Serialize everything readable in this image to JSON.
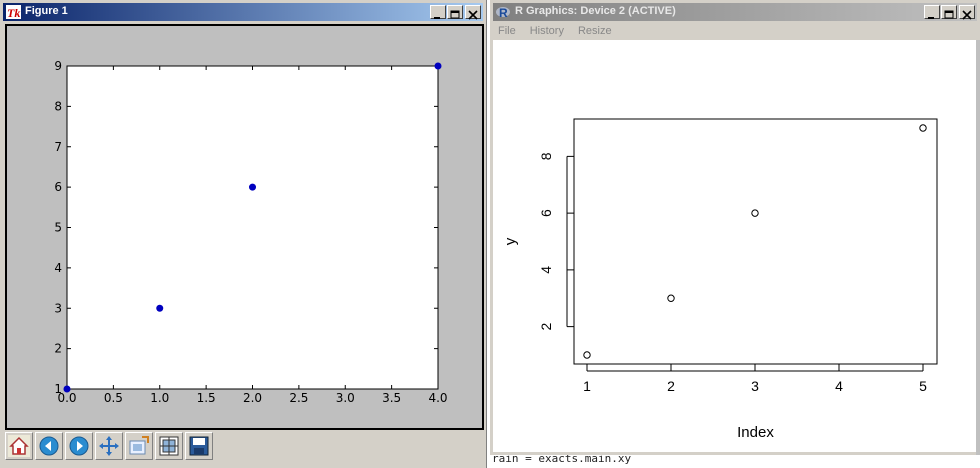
{
  "background_text": "rain = exacts.main.xy",
  "figure1": {
    "title": "Figure 1",
    "chart_data": {
      "type": "scatter",
      "x": [
        0,
        1,
        2,
        4
      ],
      "y": [
        1,
        3,
        6,
        9
      ],
      "xlim": [
        0,
        4
      ],
      "ylim": [
        1,
        9
      ],
      "xticks": [
        "0.0",
        "0.5",
        "1.0",
        "1.5",
        "2.0",
        "2.5",
        "3.0",
        "3.5",
        "4.0"
      ],
      "yticks": [
        "1",
        "2",
        "3",
        "4",
        "5",
        "6",
        "7",
        "8",
        "9"
      ],
      "marker_color": "#0000bf",
      "title": "",
      "xlabel": "",
      "ylabel": ""
    },
    "toolbar": [
      {
        "name": "home-icon"
      },
      {
        "name": "back-icon"
      },
      {
        "name": "forward-icon"
      },
      {
        "name": "pan-icon"
      },
      {
        "name": "zoom-icon"
      },
      {
        "name": "configure-subplots-icon"
      },
      {
        "name": "save-icon"
      }
    ]
  },
  "rdevice": {
    "title": "R Graphics: Device 2 (ACTIVE)",
    "menu": [
      "File",
      "History",
      "Resize"
    ],
    "chart_data": {
      "type": "scatter",
      "x": [
        1,
        2,
        3,
        5
      ],
      "y": [
        1,
        3,
        6,
        9
      ],
      "xlim": [
        1,
        5
      ],
      "ylim": [
        1,
        9
      ],
      "xticks": [
        "1",
        "2",
        "3",
        "4",
        "5"
      ],
      "yticks": [
        "2",
        "4",
        "6",
        "8"
      ],
      "xlabel": "Index",
      "ylabel": "y",
      "title": ""
    }
  }
}
